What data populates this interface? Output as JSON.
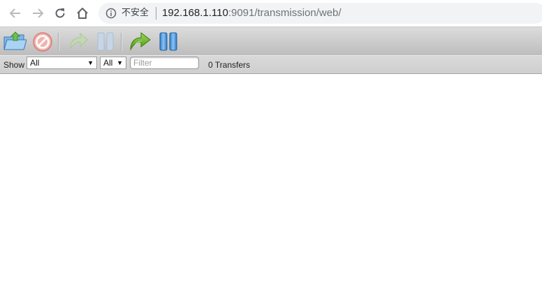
{
  "browser": {
    "security_label": "不安全",
    "url_host": "192.168.1.110",
    "url_path": ":9091/transmission/web/"
  },
  "toolbar": {
    "buttons": [
      {
        "name": "open-torrent",
        "enabled": true
      },
      {
        "name": "remove-torrent",
        "enabled": false
      },
      {
        "name": "resume-torrent",
        "enabled": false
      },
      {
        "name": "pause-torrent",
        "enabled": false
      },
      {
        "name": "resume-all",
        "enabled": true
      },
      {
        "name": "pause-all",
        "enabled": true
      }
    ]
  },
  "filterbar": {
    "show_label": "Show",
    "state_filter": "All",
    "tracker_filter": "All",
    "filter_placeholder": "Filter",
    "filter_value": "",
    "transfer_count": "0 Transfers"
  },
  "colors": {
    "toolbar_top": "#dcdcdc",
    "toolbar_bottom": "#bdbdbd",
    "accent_blue": "#3a8fd9",
    "accent_green": "#5aa81e"
  }
}
